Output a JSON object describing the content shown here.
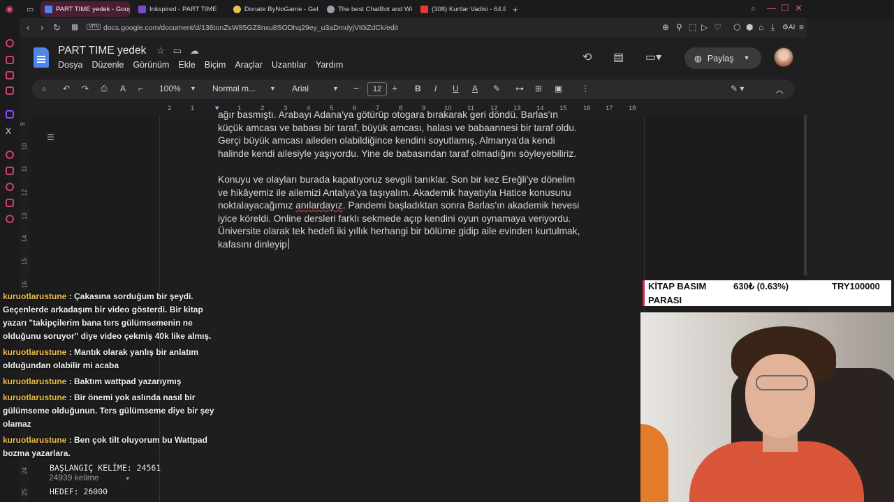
{
  "tabs": [
    {
      "label": "PART TIME yedek - Google",
      "color": "#4f86ec",
      "active": true
    },
    {
      "label": "Inkspired - PART TIME",
      "color": "#7b4cc2",
      "active": false
    },
    {
      "label": "Donate ByNoGame - Geli",
      "color": "#e8c24b",
      "active": false
    },
    {
      "label": "The best ChatBot and Wi",
      "color": "#9aa0a6",
      "active": false
    },
    {
      "label": "(308) Kurtlar Vadisi - 64.B",
      "color": "#e53935",
      "active": false
    }
  ],
  "browser": {
    "vpn": "VPN",
    "url": "docs.google.com/document/d/136tonZsW85GZ8nxu8SODhq29ey_u3aDmdyjVt0iZdCk/edit",
    "ai_label": "AI"
  },
  "doc": {
    "title": "PART TIME  yedek",
    "menu": [
      "Dosya",
      "Düzenle",
      "Görünüm",
      "Ekle",
      "Biçim",
      "Araçlar",
      "Uzantılar",
      "Yardım"
    ],
    "share_label": "Paylaş"
  },
  "toolbar": {
    "zoom": "100%",
    "style": "Normal m...",
    "font": "Arial",
    "font_size": "12"
  },
  "ruler": {
    "h_ticks": [
      "2",
      "1",
      "1",
      "2",
      "3",
      "4",
      "5",
      "6",
      "7",
      "8",
      "9",
      "10",
      "11",
      "12",
      "13",
      "14",
      "15",
      "16",
      "17",
      "18"
    ],
    "v_ticks": [
      "9",
      "10",
      "11",
      "12",
      "13",
      "14",
      "15",
      "16",
      "24",
      "25"
    ]
  },
  "body": {
    "line0": "ağır basmıştı. Arabayı Adana'ya götürüp otogara bırakarak geri döndü. Barlas'ın",
    "line1": "küçük amcası ve babası bir taraf, büyük amcası, halası ve babaannesi bir taraf oldu.",
    "line2": "Gerçi büyük amcası aileden olabildiğince kendini soyutlamış, Almanya'da kendi",
    "line3": "halinde kendi ailesiyle yaşıyordu. Yine de babasından taraf olmadığını söyleyebiliriz.",
    "p2_line1": "Konuyu ve olayları burada kapatıyoruz sevgili tanıklar. Son bir kez Ereğli'ye dönelim",
    "p2_line2": "ve hikâyemiz ile ailemizi Antalya'ya taşıyalım. Akademik hayatıyla Hatice konusunu",
    "p2_line3a": "noktalayacağımız ",
    "p2_line3b": "anılardayız",
    "p2_line3c": ". Pandemi başladıktan sonra Barlas'ın akademik hevesi",
    "p2_line4": "iyice köreldi. Online dersleri farklı sekmede açıp kendini oyun oynamaya veriyordu.",
    "p2_line5": "Üniversite olarak tek hedefi iki yıllık herhangi bir bölüme gidip aile evinden kurtulmak,",
    "p2_line6": "kafasını dinleyip"
  },
  "chat": [
    {
      "user": "kuruotlarustune",
      "text": ": Çakasına sorduğum bir şeydi. Geçenlerde arkadaşım bir video gösterdi. Bir kitap yazarı \"takipçilerim bana ters gülümsemenin ne olduğunu soruyor\" diye video çekmiş 40k like almış."
    },
    {
      "user": "kuruotlarustune",
      "text": ": Mantık olarak yanlış bir anlatım olduğundan olabilir mi acaba"
    },
    {
      "user": "kuruotlarustune",
      "text": ": Baktım wattpad yazarıymış"
    },
    {
      "user": "kuruotlarustune",
      "text": ": Bir önemi yok aslında nasıl bir gülümseme olduğunun. Ters gülümseme diye bir şey olamaz"
    },
    {
      "user": "kuruotlarustune",
      "text": ": Ben çok tilt oluyorum bu Wattpad bozma yazarlara."
    }
  ],
  "counter": {
    "start": "BAŞLANGIÇ KELİME: 24561",
    "wordcount": "24939 kelime",
    "target": "HEDEF: 26000"
  },
  "donation": {
    "label_line1": "KİTAP BASIM",
    "label_line2": "PARASI",
    "amount": "630₺ (0.63%)",
    "goal": "TRY100000",
    "progress_percent": 0.63
  }
}
